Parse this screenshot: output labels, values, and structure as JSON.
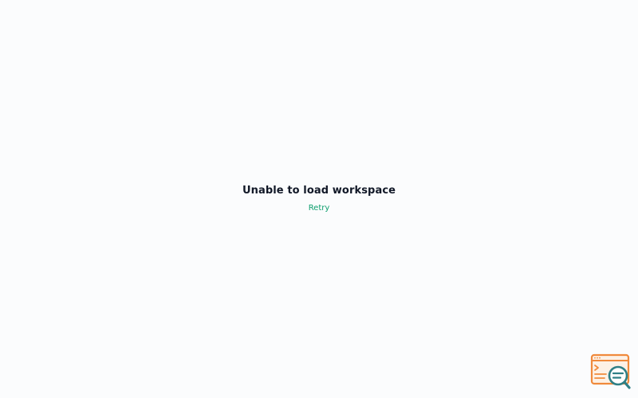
{
  "error": {
    "title": "Unable to load workspace",
    "retry_label": "Retry"
  },
  "colors": {
    "background": "#fbfcfd",
    "title": "#111827",
    "link": "#0e9f6e",
    "widget_window": "#f08a3c",
    "widget_magnifier": "#2f7f86"
  },
  "icons": {
    "corner_widget": "browser-inspect-icon"
  }
}
